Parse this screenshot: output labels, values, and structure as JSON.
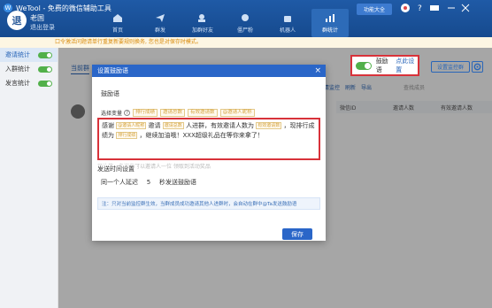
{
  "app": {
    "title": "WeTool - 免费的微信辅助工具",
    "function_button": "功能大全"
  },
  "user": {
    "avatar_char": "退",
    "name": "老国",
    "logout": "退出登录"
  },
  "nav": {
    "items": [
      {
        "label": "首页",
        "icon": "home-icon"
      },
      {
        "label": "群发",
        "icon": "send-icon"
      },
      {
        "label": "加群好友",
        "icon": "add-friend-icon"
      },
      {
        "label": "僵尸粉",
        "icon": "ghost-icon"
      },
      {
        "label": "机器人",
        "icon": "robot-icon"
      },
      {
        "label": "群统计",
        "icon": "stats-icon",
        "active": true
      }
    ]
  },
  "notice": "口令激活问题请单行重复新要规则换务, 您也是对保存时模式。",
  "sidebar": {
    "items": [
      {
        "label": "邀请统计",
        "toggle": true
      },
      {
        "label": "入群统计",
        "toggle": true
      },
      {
        "label": "发言统计",
        "toggle": true
      }
    ]
  },
  "main": {
    "tab": "当前群",
    "encourage_label": "鼓励语",
    "encourage_link": "点此设置",
    "monitor_button": "设置监控群",
    "toolbar": [
      "清监控",
      "刷新",
      "导出"
    ],
    "search_hint": "查找成员",
    "table_headers": [
      "微信ID",
      "邀请人数",
      "有效邀请人数"
    ]
  },
  "dialog": {
    "title": "设置鼓励语",
    "section_encourage": "鼓励语",
    "var_label": "选择变量",
    "variables": [
      "排行成绩",
      "邀请总数",
      "有效邀请数",
      "@邀请人昵称"
    ],
    "editor": {
      "p1": "感谢",
      "c1": "@邀请人昵称",
      "p2": "邀请",
      "c2": "邀请总数",
      "p3": "人进群，有效邀请人数为",
      "c3": "有效邀请数",
      "p4": "，现排行成绩为",
      "c4": "排行成绩",
      "p5": "，继续加油哦！XXX超级礼品在等你来拿了！"
    },
    "faded_line": "口让第一条消息可以邀请人一位 领取到活动奖品",
    "section_send": "发送时间设置",
    "delay_prefix": "同一个人延迟",
    "delay_value": "5",
    "delay_suffix": "秒发送鼓励语",
    "tip": "注：只对当前监控群生效，当群成员成功邀请其他人进群时，会自动在群中@Ta发送鼓励语",
    "save_button": "保存"
  }
}
